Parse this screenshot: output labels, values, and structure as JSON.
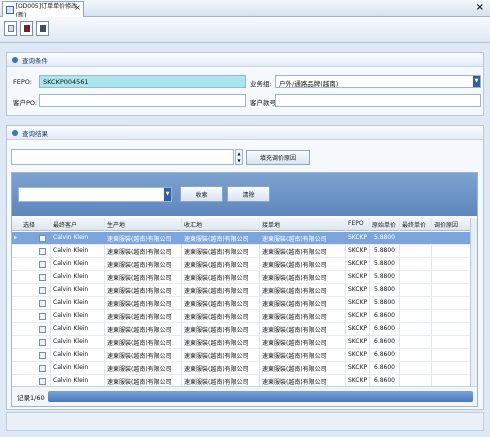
{
  "tab": {
    "title": "[OD005]订单单价修改(新)",
    "close": "×"
  },
  "window": {
    "close": "×"
  },
  "toolbar": {
    "buttons": [
      "doc-icon",
      "save-icon",
      "export-icon"
    ]
  },
  "query_panel": {
    "title": "查询条件",
    "fepo_label": "FEPO:",
    "fepo_value": "SKCKP004561",
    "business_label": "业务组:",
    "business_value": "户外/通路品牌(越南)",
    "customer_po_label": "客户PO:",
    "customer_po_value": "",
    "customer_style_label": "客户款号:",
    "customer_style_value": ""
  },
  "result_panel": {
    "title": "查询结果",
    "reason_input_value": "",
    "fill_reason_button": "填充调价原因",
    "filter_value": "",
    "search_button": "收索",
    "clear_button": "清除"
  },
  "grid": {
    "headers": [
      "选择",
      "最终客户",
      "生产地",
      "收汇地",
      "接单地",
      "FEPO",
      "原始单价",
      "最终单价",
      "调价原因"
    ],
    "rows": [
      [
        "Calvin Klein",
        "速東服裝(越南)有限公司",
        "速東服裝(越南)有限公司",
        "速東服裝(越南)有限公司",
        "SKCKP",
        "5.8800"
      ],
      [
        "Calvin Klein",
        "速東服裝(越南)有限公司",
        "速東服裝(越南)有限公司",
        "速東服裝(越南)有限公司",
        "SKCKP",
        "5.8800"
      ],
      [
        "Calvin Klein",
        "速東服裝(越南)有限公司",
        "速東服裝(越南)有限公司",
        "速東服裝(越南)有限公司",
        "SKCKP",
        "5.8800"
      ],
      [
        "Calvin Klein",
        "速東服裝(越南)有限公司",
        "速東服裝(越南)有限公司",
        "速東服裝(越南)有限公司",
        "SKCKP",
        "5.8800"
      ],
      [
        "Calvin Klein",
        "速東服裝(越南)有限公司",
        "速東服裝(越南)有限公司",
        "速東服裝(越南)有限公司",
        "SKCKP",
        "5.8800"
      ],
      [
        "Calvin Klein",
        "速東服裝(越南)有限公司",
        "速東服裝(越南)有限公司",
        "速東服裝(越南)有限公司",
        "SKCKP",
        "5.8800"
      ],
      [
        "Calvin Klein",
        "速東服裝(越南)有限公司",
        "速東服裝(越南)有限公司",
        "速東服裝(越南)有限公司",
        "SKCKP",
        "6.8600"
      ],
      [
        "Calvin Klein",
        "速東服裝(越南)有限公司",
        "速東服裝(越南)有限公司",
        "速東服裝(越南)有限公司",
        "SKCKP",
        "6.8600"
      ],
      [
        "Calvin Klein",
        "速東服裝(越南)有限公司",
        "速東服裝(越南)有限公司",
        "速東服裝(越南)有限公司",
        "SKCKP",
        "6.8600"
      ],
      [
        "Calvin Klein",
        "速東服裝(越南)有限公司",
        "速東服裝(越南)有限公司",
        "速東服裝(越南)有限公司",
        "SKCKP",
        "6.8600"
      ],
      [
        "Calvin Klein",
        "速東服裝(越南)有限公司",
        "速東服裝(越南)有限公司",
        "速東服裝(越南)有限公司",
        "SKCKP",
        "6.8600"
      ],
      [
        "Calvin Klein",
        "速東服裝(越南)有限公司",
        "速東服裝(越南)有限公司",
        "速東服裝(越南)有限公司",
        "SKCKP",
        "6.8600"
      ]
    ],
    "record_text": "记录1/60"
  }
}
